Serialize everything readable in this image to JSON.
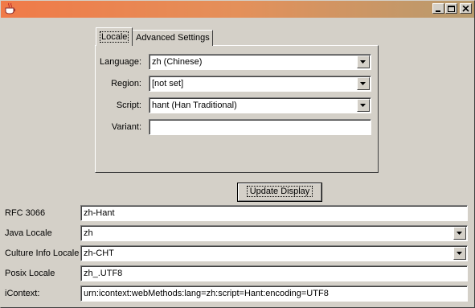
{
  "window": {
    "title": "",
    "controls": {
      "minimize": "minimize-icon",
      "maximize": "maximize-icon",
      "close": "close-icon"
    }
  },
  "tabs": [
    {
      "label": "Locale",
      "selected": true
    },
    {
      "label": "Advanced Settings",
      "selected": false
    }
  ],
  "locale_panel": {
    "language_label": "Language:",
    "language_value": "zh (Chinese)",
    "region_label": "Region:",
    "region_value": "[not set]",
    "script_label": "Script:",
    "script_value": "hant (Han Traditional)",
    "variant_label": "Variant:",
    "variant_value": ""
  },
  "update_button_label": "Update Display",
  "results": {
    "rfc_label": "RFC 3066",
    "rfc_value": "zh-Hant",
    "java_label": "Java Locale",
    "java_value": "zh",
    "culture_label": "Culture Info Locale",
    "culture_value": "zh-CHT",
    "posix_label": "Posix Locale",
    "posix_value": "zh_.UTF8",
    "icontext_label": "iContext:",
    "icontext_value": "urn:icontext:webMethods:lang=zh:script=Hant:encoding=UTF8"
  },
  "colors": {
    "title_gradient_start": "#f07a48",
    "title_gradient_end": "#b79b6e",
    "window_bg": "#d4d0c8"
  }
}
